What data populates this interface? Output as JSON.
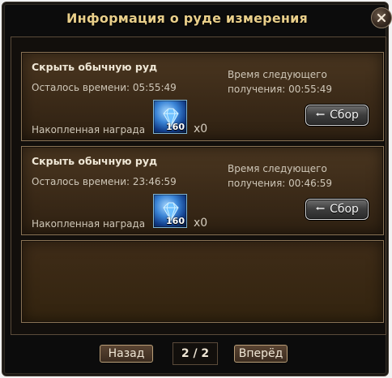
{
  "window": {
    "title": "Информация о руде измерения"
  },
  "cards": [
    {
      "name": "Скрыть обычную руд",
      "remaining_label": "Осталось времени: 05:55:49",
      "accumulated_label": "Накопленная награда",
      "next_line1": "Время следующего",
      "next_line2": "получения: 00:55:49",
      "reward_count": "160",
      "multiplier": "x0",
      "collect_label": "Сбор"
    },
    {
      "name": "Скрыть обычную руд",
      "remaining_label": "Осталось времени: 23:46:59",
      "accumulated_label": "Накопленная награда",
      "next_line1": "Время следующего",
      "next_line2": "получения: 00:46:59",
      "reward_count": "160",
      "multiplier": "x0",
      "collect_label": "Сбор"
    }
  ],
  "footer": {
    "back_label": "Назад",
    "page_indicator": "2 / 2",
    "forward_label": "Вперёд"
  },
  "icons": {
    "close": "close-icon",
    "reward": "blue-gem-icon",
    "collect": "collect-icon"
  },
  "colors": {
    "title_gold": "#e9cf8a",
    "card_brown": "#3b2a18",
    "button_gray": "#3d3d3d"
  }
}
